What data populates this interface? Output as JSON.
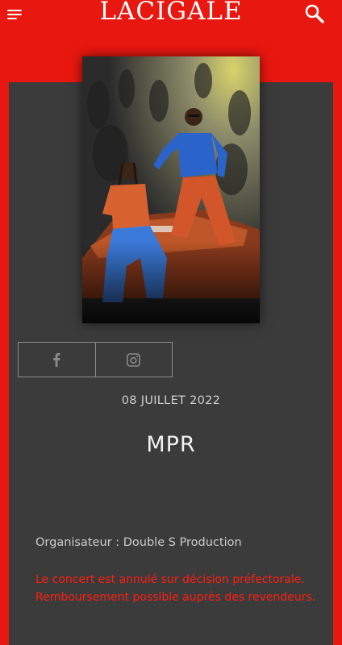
{
  "header": {
    "logo_text": "LACIGALE",
    "menu_icon": "hamburger-menu-icon",
    "search_icon": "search-icon"
  },
  "event": {
    "poster_alt": "MPR",
    "social": [
      {
        "name": "facebook",
        "icon": "facebook-icon"
      },
      {
        "name": "instagram",
        "icon": "instagram-icon"
      }
    ],
    "date": "08 JUILLET 2022",
    "title": "MPR",
    "organizer": "Organisateur : Double S Production",
    "notice": "Le concert est annulé sur décision préfectorale. Remboursement possible auprès des revendeurs."
  },
  "colors": {
    "brand_red": "#e8170f",
    "panel_bg": "#3b3b3b",
    "notice_red": "#ff1d12"
  }
}
